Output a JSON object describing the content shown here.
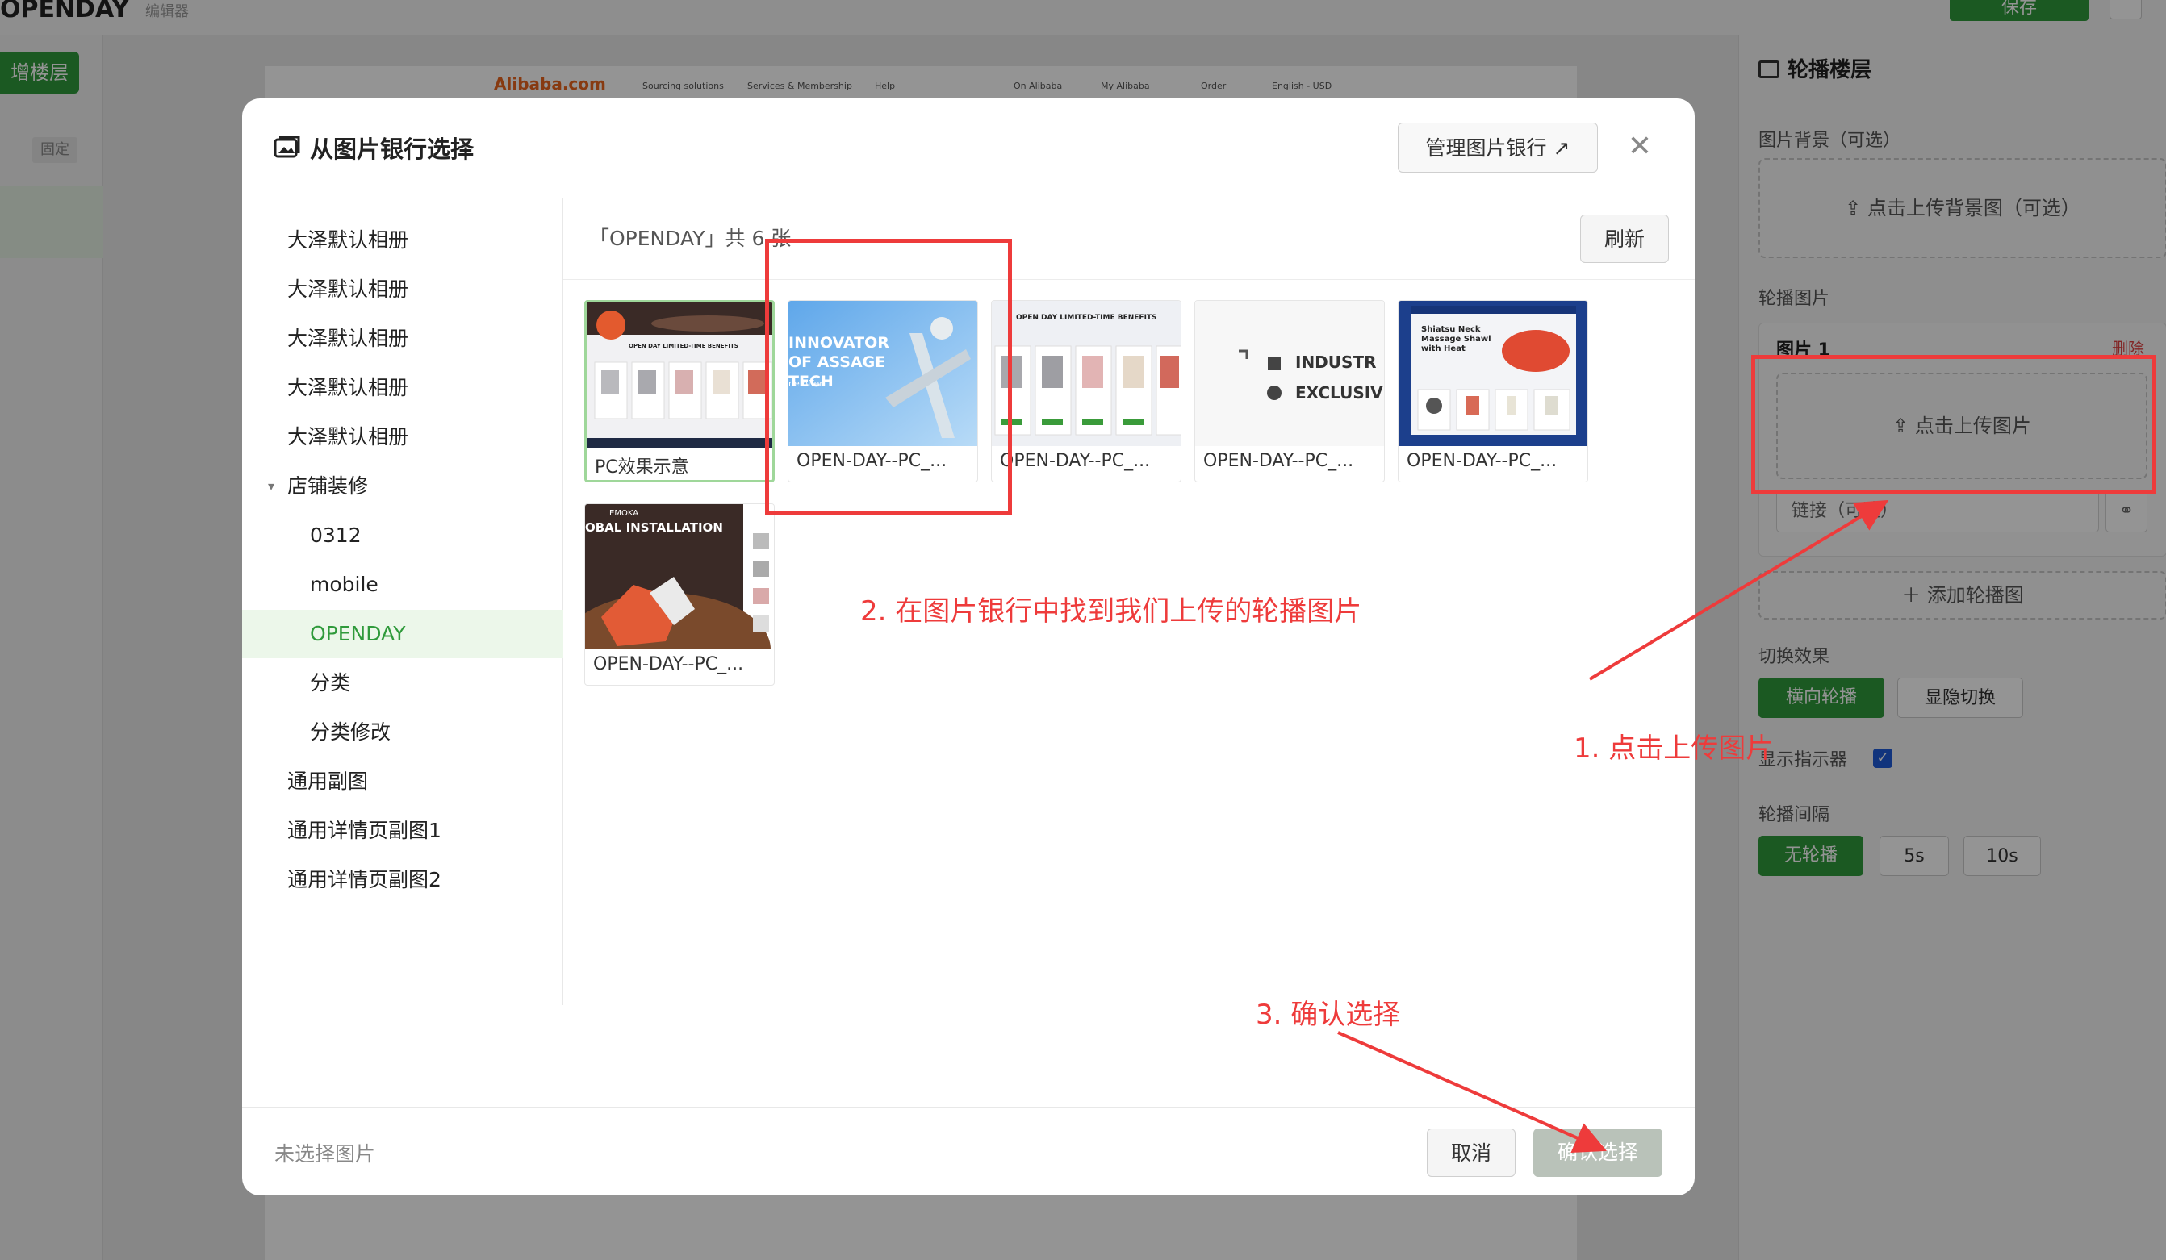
{
  "colors": {
    "brand_green": "#2f9a3b",
    "annotation_red": "#ee3b3b",
    "alibaba_orange": "#e8641e"
  },
  "background": {
    "topbar": {
      "logo": "OPENDAY",
      "subtitle": "编辑器",
      "save_label": "保存"
    },
    "left": {
      "add_floor": "增楼层",
      "fixed_tag": "固定"
    },
    "alibaba": {
      "logo": "Alibaba.com",
      "nav": [
        "Sourcing solutions",
        "Services & Membership",
        "Help",
        "On Alibaba",
        "My Alibaba",
        "Order",
        "English - USD"
      ]
    },
    "right_panel": {
      "title": "轮播楼层",
      "bg_label": "图片背景（可选）",
      "bg_upload": "点击上传背景图（可选）",
      "images_label": "轮播图片",
      "image_item": "图片 1",
      "delete": "删除",
      "upload_image": "点击上传图片",
      "link_placeholder": "链接（可选）",
      "add_carousel": "添加轮播图",
      "effect_label": "切换效果",
      "effect_options": [
        "横向轮播",
        "显隐切换"
      ],
      "indicator_label": "显示指示器",
      "interval_label": "轮播间隔",
      "interval_options": [
        "无轮播",
        "5s",
        "10s"
      ]
    }
  },
  "modal": {
    "title": "从图片银行选择",
    "title_icon": "image-gallery-icon",
    "manage_label": "管理图片银行 ↗",
    "close_icon": "close-icon",
    "sidebar": [
      {
        "label": "大泽默认相册",
        "level": 0
      },
      {
        "label": "大泽默认相册",
        "level": 0
      },
      {
        "label": "大泽默认相册",
        "level": 0
      },
      {
        "label": "大泽默认相册",
        "level": 0
      },
      {
        "label": "大泽默认相册",
        "level": 0
      },
      {
        "label": "店铺装修",
        "level": 0,
        "expanded": true
      },
      {
        "label": "0312",
        "level": 1
      },
      {
        "label": "mobile",
        "level": 1
      },
      {
        "label": "OPENDAY",
        "level": 1,
        "active": true
      },
      {
        "label": "分类",
        "level": 1
      },
      {
        "label": "分类修改",
        "level": 1
      },
      {
        "label": "通用副图",
        "level": 0
      },
      {
        "label": "通用详情页副图1",
        "level": 0
      },
      {
        "label": "通用详情页副图2",
        "level": 0
      }
    ],
    "crumb": "「OPENDAY」共 6 张",
    "refresh_label": "刷新",
    "images": [
      {
        "caption": "PC效果示意",
        "selected": true,
        "thumb_text": "OPEN DAY LIMITED-TIME BENEFITS"
      },
      {
        "caption": "OPEN-DAY--PC_...",
        "thumb_text": "INNOVATOR OF ASSAGE TECH",
        "thumb_sub": "ne offer"
      },
      {
        "caption": "OPEN-DAY--PC_...",
        "thumb_text": "OPEN DAY LIMITED-TIME BENEFITS"
      },
      {
        "caption": "OPEN-DAY--PC_...",
        "thumb_text": "INDUSTR",
        "thumb_sub": "EXCLUSIV"
      },
      {
        "caption": "OPEN-DAY--PC_...",
        "thumb_text": "Shiatsu Neck Massage Shawl with Heat"
      },
      {
        "caption": "OPEN-DAY--PC_...",
        "thumb_text": "OBAL INSTALLATION",
        "thumb_sub": "EMOKA"
      }
    ],
    "footer_status": "未选择图片",
    "cancel_label": "取消",
    "confirm_label": "确认选择"
  },
  "annotations": {
    "step1": "1. 点击上传图片",
    "step2": "2. 在图片银行中找到我们上传的轮播图片",
    "step3": "3. 确认选择"
  }
}
